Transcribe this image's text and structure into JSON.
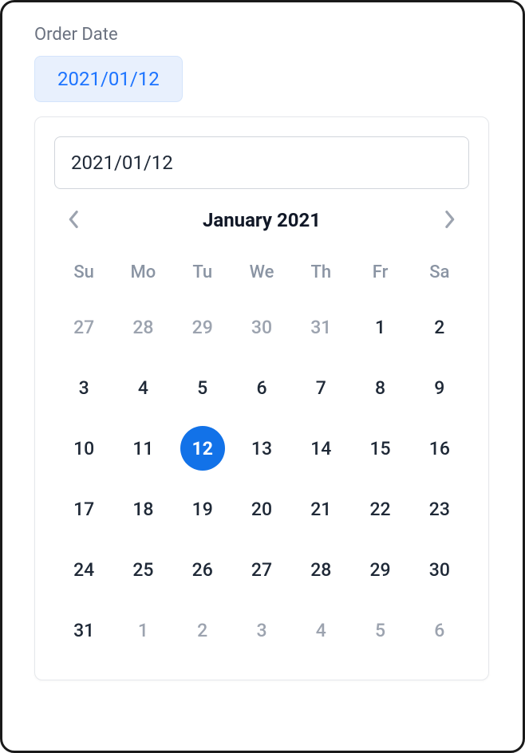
{
  "field": {
    "label": "Order Date",
    "pill_value": "2021/01/12"
  },
  "datepicker": {
    "input_value": "2021/01/12",
    "month_title": "January 2021",
    "weekdays": [
      "Su",
      "Mo",
      "Tu",
      "We",
      "Th",
      "Fr",
      "Sa"
    ],
    "days": [
      {
        "n": "27",
        "outside": true,
        "selected": false
      },
      {
        "n": "28",
        "outside": true,
        "selected": false
      },
      {
        "n": "29",
        "outside": true,
        "selected": false
      },
      {
        "n": "30",
        "outside": true,
        "selected": false
      },
      {
        "n": "31",
        "outside": true,
        "selected": false
      },
      {
        "n": "1",
        "outside": false,
        "selected": false
      },
      {
        "n": "2",
        "outside": false,
        "selected": false
      },
      {
        "n": "3",
        "outside": false,
        "selected": false
      },
      {
        "n": "4",
        "outside": false,
        "selected": false
      },
      {
        "n": "5",
        "outside": false,
        "selected": false
      },
      {
        "n": "6",
        "outside": false,
        "selected": false
      },
      {
        "n": "7",
        "outside": false,
        "selected": false
      },
      {
        "n": "8",
        "outside": false,
        "selected": false
      },
      {
        "n": "9",
        "outside": false,
        "selected": false
      },
      {
        "n": "10",
        "outside": false,
        "selected": false
      },
      {
        "n": "11",
        "outside": false,
        "selected": false
      },
      {
        "n": "12",
        "outside": false,
        "selected": true
      },
      {
        "n": "13",
        "outside": false,
        "selected": false
      },
      {
        "n": "14",
        "outside": false,
        "selected": false
      },
      {
        "n": "15",
        "outside": false,
        "selected": false
      },
      {
        "n": "16",
        "outside": false,
        "selected": false
      },
      {
        "n": "17",
        "outside": false,
        "selected": false
      },
      {
        "n": "18",
        "outside": false,
        "selected": false
      },
      {
        "n": "19",
        "outside": false,
        "selected": false
      },
      {
        "n": "20",
        "outside": false,
        "selected": false
      },
      {
        "n": "21",
        "outside": false,
        "selected": false
      },
      {
        "n": "22",
        "outside": false,
        "selected": false
      },
      {
        "n": "23",
        "outside": false,
        "selected": false
      },
      {
        "n": "24",
        "outside": false,
        "selected": false
      },
      {
        "n": "25",
        "outside": false,
        "selected": false
      },
      {
        "n": "26",
        "outside": false,
        "selected": false
      },
      {
        "n": "27",
        "outside": false,
        "selected": false
      },
      {
        "n": "28",
        "outside": false,
        "selected": false
      },
      {
        "n": "29",
        "outside": false,
        "selected": false
      },
      {
        "n": "30",
        "outside": false,
        "selected": false
      },
      {
        "n": "31",
        "outside": false,
        "selected": false
      },
      {
        "n": "1",
        "outside": true,
        "selected": false
      },
      {
        "n": "2",
        "outside": true,
        "selected": false
      },
      {
        "n": "3",
        "outside": true,
        "selected": false
      },
      {
        "n": "4",
        "outside": true,
        "selected": false
      },
      {
        "n": "5",
        "outside": true,
        "selected": false
      },
      {
        "n": "6",
        "outside": true,
        "selected": false
      }
    ]
  }
}
